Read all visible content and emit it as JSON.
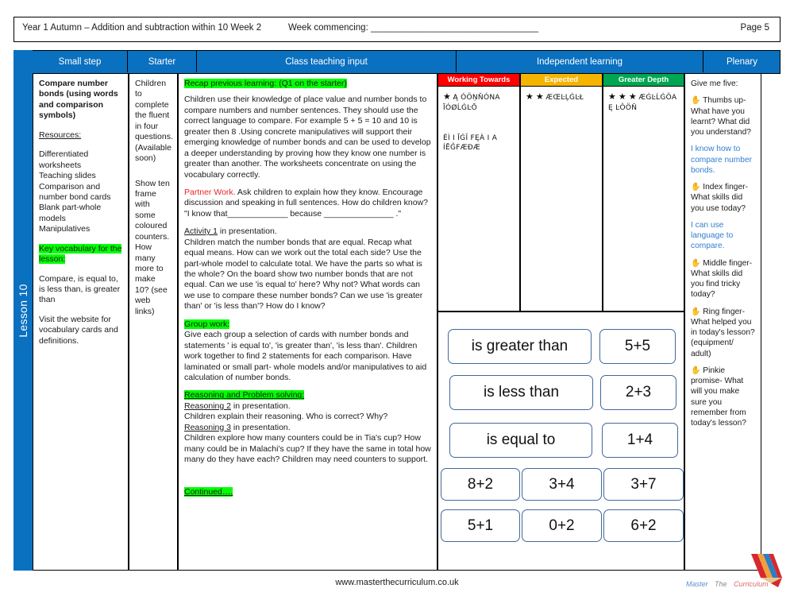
{
  "header": {
    "title": "Year 1 Autumn – Addition and subtraction within 10 Week 2",
    "week_commencing": "Week commencing: _________________________________",
    "page": "Page 5"
  },
  "lesson_spine": {
    "label": "Lesson 10"
  },
  "columns": {
    "small_step": "Small step",
    "starter": "Starter",
    "class_teaching_input": "Class teaching input",
    "independent_learning": "Independent learning",
    "plenary": "Plenary"
  },
  "small_step": {
    "title": "Compare number bonds (using words and comparison symbols)",
    "resources_heading": "Resources:",
    "resources": "Differentiated worksheets\nTeaching slides\nComparison and number bond cards\nBlank part-whole models\nManipulatives",
    "key_vocab_heading": "Key vocabulary for the lesson:",
    "key_vocab": "Compare, is equal to, is less than, is greater than",
    "website_note": "Visit the website for vocabulary cards and definitions."
  },
  "starter": {
    "para1": "Children to complete the fluent in four questions. (Available soon)",
    "para2": "Show ten frame with some coloured counters. How many more to make 10? (see web links)"
  },
  "class_teaching": {
    "recap_heading": "Recap previous learning: (Q1 on the starter)",
    "recap_body": "Children use their knowledge of place value and number bonds to compare numbers and number sentences. They should use the correct language to compare. For example 5 + 5 = 10 and 10 is greater then 8 .Using concrete manipulatives will support their emerging knowledge of number bonds and can be used to develop a deeper understanding by proving how they know one number is greater than another. The worksheets concentrate on using the vocabulary correctly.",
    "partner_work_label": "Partner Work.",
    "partner_work_body": " Ask children to explain how they know. Encourage discussion and speaking in full sentences. How do children know?  \"I know that_____________ because _______________ .\"",
    "activity1_label": "Activity 1",
    "activity1_tail": " in presentation.",
    "activity1_body": "Children match the number bonds that are equal. Recap what equal means. How can we work out the total each side? Use the part-whole model to calculate total. We have the parts so what is the whole? On the board show two number bonds that are not equal. Can we use 'is equal to' here? Why not? What words can we use to compare these number bonds?  Can we use 'is greater than' or 'is less than'? How do I know?",
    "group_work_heading": "Group work:",
    "group_work_body": "Give each group a selection of cards with number bonds and statements ' is equal to', 'is greater than', 'is less than'. Children work together to find 2 statements for each comparison. Have laminated or small part- whole models and/or manipulatives to aid calculation of number bonds.",
    "reasoning_heading": "Reasoning and Problem solving:",
    "reasoning2_label": "Reasoning 2",
    "reasoning2_tail": " in presentation.",
    "reasoning2_body": "Children explain their reasoning. Who is correct? Why?",
    "reasoning3_label": "Reasoning 3",
    "reasoning3_tail": " in presentation.",
    "reasoning3_body": "Children explore how many counters could be in Tia's cup? How many could be in Malachi's cup? If they have the same in total how many do they have each? Children may need counters to support.",
    "continued": "Continued…."
  },
  "independent_learning": {
    "levels": [
      {
        "label": "Working Towards",
        "color": "#ff0000",
        "stars": "★",
        "line1": "Ą ÓÖŅŇÓNA",
        "line2": "ĪÓØĹĠĿŌ",
        "line3": "ĖÌ I ĪĠĬ FĘÀ I A",
        "line4": "ÍĒĜFÆÐÆ"
      },
      {
        "label": "Expected",
        "color": "#f5b400",
        "stars": "★ ★",
        "line1": "ÆŒĿĻĠĿŁ",
        "line2": "",
        "line3": "",
        "line4": ""
      },
      {
        "label": "Greater Depth",
        "color": "#00a651",
        "stars": "★ ★ ★",
        "line1": "ÆĠĿĹĠÖA",
        "line2": "Ę ĿÔÖŇ",
        "line3": "",
        "line4": ""
      }
    ]
  },
  "card_panel": {
    "cards": [
      {
        "text": "is greater than"
      },
      {
        "text": "5+5"
      },
      {
        "text": "is less than"
      },
      {
        "text": "2+3"
      },
      {
        "text": "is equal to"
      },
      {
        "text": "1+4"
      },
      {
        "text": "8+2"
      },
      {
        "text": "3+4"
      },
      {
        "text": "3+7"
      },
      {
        "text": "5+1"
      },
      {
        "text": "0+2"
      },
      {
        "text": "6+2"
      }
    ]
  },
  "plenary": {
    "intro": "Give me five:",
    "items": [
      {
        "icon": "✋",
        "question": "Thumbs up- What have you learnt? What did you understand?",
        "answer": "I know how to compare number bonds."
      },
      {
        "icon": "✋",
        "question": "Index finger- What skills did you use today?",
        "answer": "I can use language to compare."
      },
      {
        "icon": "✋",
        "question": "Middle finger- What skills did you find tricky today?",
        "answer": ""
      },
      {
        "icon": "✋",
        "question": "Ring finger- What helped you in today's lesson? (equipment/ adult)",
        "answer": ""
      },
      {
        "icon": "✋",
        "question": "Pinkie promise- What will you make sure you remember from today's lesson?",
        "answer": ""
      }
    ]
  },
  "footer": {
    "url": "www.masterthecurriculum.co.uk",
    "logo_word1": "Master",
    "logo_word2": "The",
    "logo_word3": "Curriculum"
  },
  "colors": {
    "brand_blue": "#0a70c0",
    "highlight_green": "#00ff00",
    "partner_red": "#e8252a",
    "answer_blue": "#2f7fd0"
  }
}
